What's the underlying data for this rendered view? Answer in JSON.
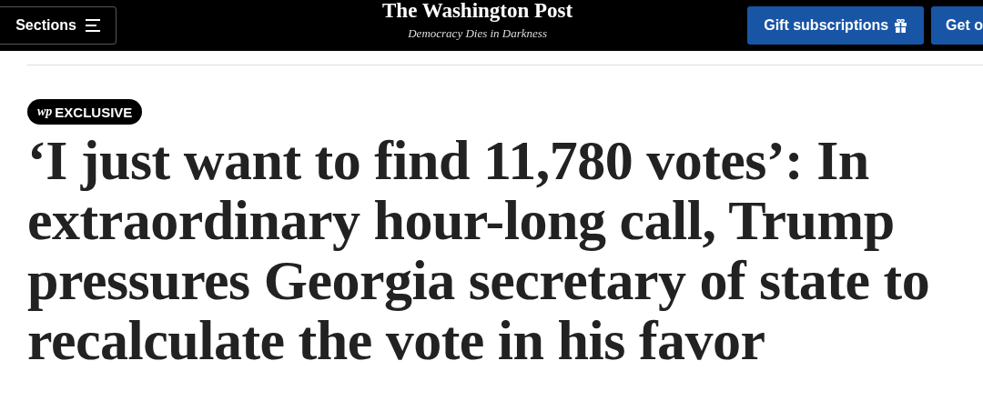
{
  "header": {
    "sections_button": "Sections",
    "logo": "The Washington Post",
    "tagline": "Democracy Dies in Darkness",
    "buttons": [
      {
        "label": "Gift subscriptions",
        "kind": "gift"
      },
      {
        "label": "Get o",
        "kind": "plain"
      }
    ]
  },
  "article": {
    "badge": {
      "mark": "wp",
      "label": "EXCLUSIVE"
    },
    "headline": "‘I just want to find 11,780 votes’: In extraordinary hour-long call, Trump pressures Georgia secretary of state to recalculate the vote in his favor"
  }
}
